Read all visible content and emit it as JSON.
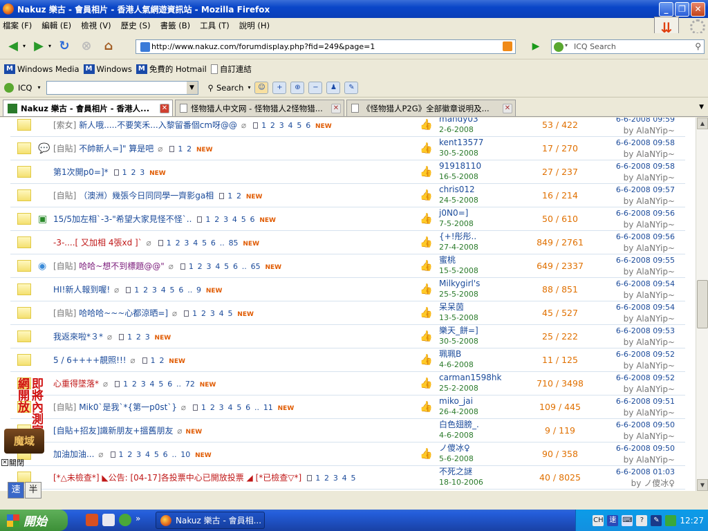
{
  "window": {
    "title": "Nakuz 樂古 - 會員相片 - 香港人氣網遊資訊站 - Mozilla Firefox"
  },
  "menu": [
    "檔案 (F)",
    "編輯 (E)",
    "檢視 (V)",
    "歷史 (S)",
    "書籤 (B)",
    "工具 (T)",
    "說明 (H)"
  ],
  "nav": {
    "url": "http://www.nakuz.com/forumdisplay.php?fid=249&page=1",
    "search_placeholder": "ICQ Search"
  },
  "bookmarks": [
    "Windows Media",
    "Windows",
    "免費的 Hotmail",
    "自訂連結"
  ],
  "icqbar": {
    "icq_label": "ICQ",
    "search_label": "Search"
  },
  "tabs": [
    {
      "label": "Nakuz 樂古 - 會員相片 - 香港人...",
      "active": true
    },
    {
      "label": "怪物猎人中文网 - 怪物猎人2怪物猎...",
      "active": false
    },
    {
      "label": "《怪物猎人P2G》全部徽章说明及...",
      "active": false
    }
  ],
  "threads": [
    {
      "prefix": "[索女]",
      "title": "新人哦.....不要笑禾...入黎留番個cm呀@@",
      "title_color": "blue",
      "clip": true,
      "pages": [
        "1",
        "2",
        "3",
        "4",
        "5",
        "6"
      ],
      "new": "NEW",
      "mood": "",
      "thumb": true,
      "author": "mandy03",
      "date": "2-6-2008",
      "stats": "53 / 422",
      "last_time": "6-6-2008 09:59",
      "last_by": "by AlaNYip~"
    },
    {
      "prefix": "[自貼]",
      "title": "不帥新人=]\" 算是吧",
      "title_color": "blue",
      "clip": true,
      "pages": [
        "1",
        "2"
      ],
      "new": "NEW",
      "mood": "speech",
      "thumb": true,
      "author": "kent13577",
      "date": "30-5-2008",
      "stats": "17 / 270",
      "last_time": "6-6-2008 09:58",
      "last_by": "by AlaNYip~"
    },
    {
      "prefix": "",
      "title": "第1次開p0=]*",
      "title_color": "blue",
      "clip": false,
      "pages": [
        "1",
        "2",
        "3"
      ],
      "new": "NEW",
      "mood": "",
      "thumb": true,
      "author": "91918110",
      "date": "16-5-2008",
      "stats": "27 / 237",
      "last_time": "6-6-2008 09:58",
      "last_by": "by AlaNYip~"
    },
    {
      "prefix": "[自貼]",
      "title": "（澳洲）幾張今日同同學一齊影ga相",
      "title_color": "blue",
      "clip": false,
      "pages": [
        "1",
        "2"
      ],
      "new": "NEW",
      "mood": "",
      "thumb": true,
      "author": "chris012",
      "date": "24-5-2008",
      "stats": "16 / 214",
      "last_time": "6-6-2008 09:57",
      "last_by": "by AlaNYip~"
    },
    {
      "prefix": "",
      "title": "15/5加左相`-3-\"希望大家見怪不怪`..",
      "title_color": "blue",
      "clip": false,
      "pages": [
        "1",
        "2",
        "3",
        "4",
        "5",
        "6"
      ],
      "new": "NEW",
      "mood": "picture",
      "thumb": true,
      "author": "j0N0=]",
      "date": "7-5-2008",
      "stats": "50 / 610",
      "last_time": "6-6-2008 09:56",
      "last_by": "by AlaNYip~"
    },
    {
      "prefix": "",
      "title": "-3-....[ 又加相 4張xd ]`",
      "title_color": "red",
      "clip": true,
      "pages": [
        "1",
        "2",
        "3",
        "4",
        "5",
        "6",
        "..",
        "85"
      ],
      "new": "NEW",
      "mood": "",
      "thumb": true,
      "author": "{+!彤彤..",
      "date": "27-4-2008",
      "stats": "849 / 2761",
      "last_time": "6-6-2008 09:56",
      "last_by": "by AlaNYip~"
    },
    {
      "prefix": "[自貼]",
      "title": "哈哈~想不到標題@@\"",
      "title_color": "purple",
      "clip": true,
      "pages": [
        "1",
        "2",
        "3",
        "4",
        "5",
        "6",
        "..",
        "65"
      ],
      "new": "NEW",
      "mood": "globe",
      "thumb": true,
      "author": "蜜桃",
      "date": "15-5-2008",
      "stats": "649 / 2337",
      "last_time": "6-6-2008 09:55",
      "last_by": "by AlaNYip~"
    },
    {
      "prefix": "",
      "title": "HI!新人報到喔!",
      "title_color": "blue",
      "clip": true,
      "pages": [
        "1",
        "2",
        "3",
        "4",
        "5",
        "6",
        "..",
        "9"
      ],
      "new": "NEW",
      "mood": "",
      "thumb": true,
      "author": "Milkygirl's",
      "date": "25-5-2008",
      "stats": "88 / 851",
      "last_time": "6-6-2008 09:54",
      "last_by": "by AlaNYip~"
    },
    {
      "prefix": "[自貼]",
      "title": "哈哈哈~~~心都涼晒=]",
      "title_color": "blue",
      "clip": true,
      "pages": [
        "1",
        "2",
        "3",
        "4",
        "5"
      ],
      "new": "NEW",
      "mood": "",
      "thumb": true,
      "author": "呆呆茵",
      "date": "13-5-2008",
      "stats": "45 / 527",
      "last_time": "6-6-2008 09:54",
      "last_by": "by AlaNYip~"
    },
    {
      "prefix": "",
      "title": "我返來啦*３*",
      "title_color": "blue",
      "clip": true,
      "pages": [
        "1",
        "2",
        "3"
      ],
      "new": "NEW",
      "mood": "",
      "thumb": true,
      "author": "樂天_餅=]",
      "date": "30-5-2008",
      "stats": "25 / 222",
      "last_time": "6-6-2008 09:53",
      "last_by": "by AlaNYip~"
    },
    {
      "prefix": "",
      "title": "5 / 6++++靚照!!!",
      "title_color": "blue",
      "clip": true,
      "pages": [
        "1",
        "2"
      ],
      "new": "NEW",
      "mood": "",
      "thumb": true,
      "author": "珮珮B",
      "date": "4-6-2008",
      "stats": "11 / 125",
      "last_time": "6-6-2008 09:52",
      "last_by": "by AlaNYip~"
    },
    {
      "prefix": "",
      "title": "心重得墜落*",
      "title_color": "red",
      "clip": true,
      "pages": [
        "1",
        "2",
        "3",
        "4",
        "5",
        "6",
        "..",
        "72"
      ],
      "new": "NEW",
      "mood": "",
      "thumb": true,
      "author": "carman1598hk",
      "date": "25-2-2008",
      "stats": "710 / 3498",
      "last_time": "6-6-2008 09:52",
      "last_by": "by AlaNYip~"
    },
    {
      "prefix": "[自貼]",
      "title": "Mik0`是我`*{第一p0st`}",
      "title_color": "blue",
      "clip": true,
      "pages": [
        "1",
        "2",
        "3",
        "4",
        "5",
        "6",
        "..",
        "11"
      ],
      "new": "NEW",
      "mood": "",
      "thumb": true,
      "author": "miko_jai",
      "date": "26-4-2008",
      "stats": "109 / 445",
      "last_time": "6-6-2008 09:51",
      "last_by": "by AlaNYip~"
    },
    {
      "prefix": "",
      "title": "[自貼+招友]識新朋友+搵舊朋友",
      "title_color": "blue",
      "clip": true,
      "pages": [],
      "new": "NEW",
      "mood": "",
      "thumb": false,
      "author": "白色翅膀_.",
      "date": "4-6-2008",
      "stats": "9 / 119",
      "last_time": "6-6-2008 09:50",
      "last_by": "by AlaNYip~"
    },
    {
      "prefix": "",
      "title": "加油加油...",
      "title_color": "blue",
      "clip": true,
      "pages": [
        "1",
        "2",
        "3",
        "4",
        "5",
        "6",
        "..",
        "10"
      ],
      "new": "NEW",
      "mood": "",
      "thumb": true,
      "author": "ノ傻冰♀",
      "date": "5-6-2008",
      "stats": "90 / 358",
      "last_time": "6-6-2008 09:50",
      "last_by": "by AlaNYip~"
    },
    {
      "prefix": "",
      "title": "[*△未檢查*] ◣公告: [04-17]各投票中心已開放投票 ◢ [*已檢查▽*]",
      "title_color": "red",
      "clip": false,
      "pages": [
        "1",
        "2",
        "3",
        "4",
        "5"
      ],
      "new": "",
      "mood": "",
      "thumb": false,
      "author": "不死之謎",
      "date": "18-10-2006",
      "stats": "40 / 8025",
      "last_time": "6-6-2008 01:03",
      "last_by": "by ノ傻冰♀"
    }
  ],
  "ad": {
    "text": "即將內測官網開放",
    "logo": "魔域",
    "close": "關閉"
  },
  "speed_buttons": [
    "速",
    "半"
  ],
  "taskbar": {
    "start": "開始",
    "window": "Nakuz 樂古 - 會員相...",
    "clock": "12:27",
    "ime": "CH"
  },
  "colors": {
    "accent": "#1a4a9a",
    "stats": "#e07000",
    "new": "#e05a00",
    "red_title": "#c01818"
  }
}
